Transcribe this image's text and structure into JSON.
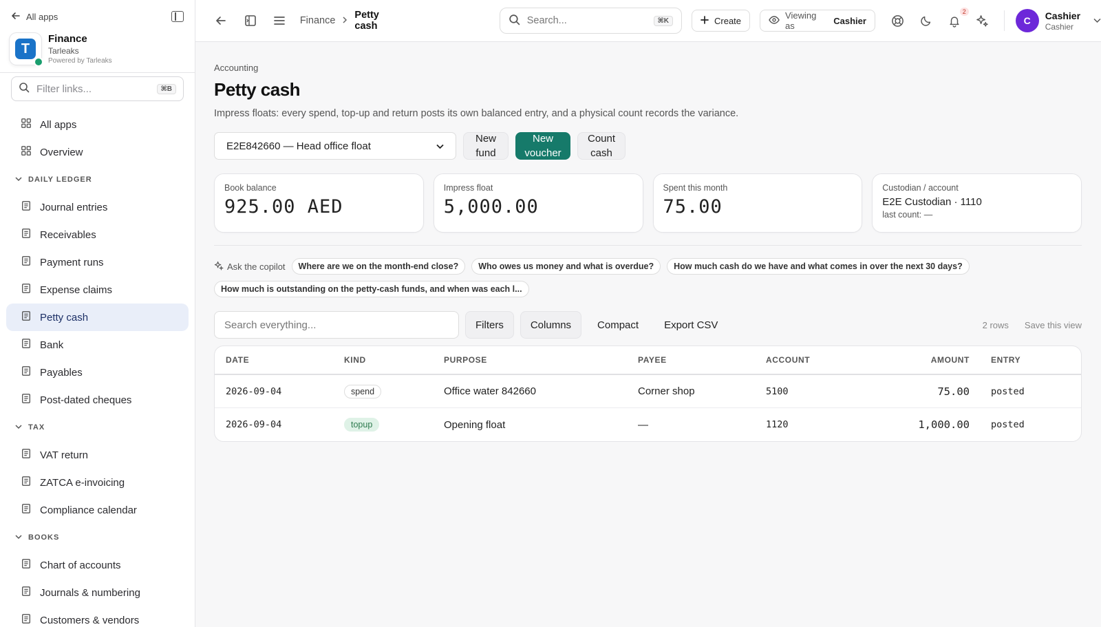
{
  "sidebar": {
    "back_label": "All apps",
    "org_name": "Finance",
    "org_sub": "Tarleaks",
    "org_powered": "Powered by Tarleaks",
    "org_logo_letter": "T",
    "filter_placeholder": "Filter links...",
    "filter_kbd": "⌘B",
    "top_items": [
      {
        "label": "All apps",
        "icon": "grid-icon"
      },
      {
        "label": "Overview",
        "icon": "grid-icon"
      }
    ],
    "sections": [
      {
        "title": "DAILY LEDGER",
        "items": [
          {
            "label": "Journal entries"
          },
          {
            "label": "Receivables"
          },
          {
            "label": "Payment runs"
          },
          {
            "label": "Expense claims"
          },
          {
            "label": "Petty cash",
            "active": true
          },
          {
            "label": "Bank"
          },
          {
            "label": "Payables"
          },
          {
            "label": "Post-dated cheques"
          }
        ]
      },
      {
        "title": "TAX",
        "items": [
          {
            "label": "VAT return"
          },
          {
            "label": "ZATCA e-invoicing"
          },
          {
            "label": "Compliance calendar"
          }
        ]
      },
      {
        "title": "BOOKS",
        "items": [
          {
            "label": "Chart of accounts"
          },
          {
            "label": "Journals & numbering"
          },
          {
            "label": "Customers & vendors"
          }
        ]
      }
    ]
  },
  "topbar": {
    "crumb_parent": "Finance",
    "crumb_current": "Petty cash",
    "search_placeholder": "Search...",
    "search_kbd": "⌘K",
    "create_label": "Create",
    "viewing_as_prefix": "Viewing as",
    "viewing_as_role": "Cashier",
    "notification_count": "2",
    "user_initial": "C",
    "user_name": "Cashier",
    "user_role": "Cashier"
  },
  "page": {
    "eyebrow": "Accounting",
    "title": "Petty cash",
    "description": "Impress floats: every spend, top-up and return posts its own balanced entry, and a physical count records the variance.",
    "fund_select": "E2E842660 — Head office float",
    "new_fund_label": "New fund",
    "new_voucher_label": "New voucher",
    "count_cash_label": "Count cash"
  },
  "cards": {
    "book_balance_label": "Book balance",
    "book_balance_value": "925.00 AED",
    "impress_label": "Impress float",
    "impress_value": "5,000.00",
    "spent_label": "Spent this month",
    "spent_value": "75.00",
    "custodian_label": "Custodian / account",
    "custodian_value": "E2E Custodian · 1110",
    "last_count": "last count: —"
  },
  "copilot": {
    "label": "Ask the copilot",
    "suggestions": [
      "Where are we on the month-end close?",
      "Who owes us money and what is overdue?",
      "How much cash do we have and what comes in over the next 30 days?",
      "How much is outstanding on the petty-cash funds, and when was each l..."
    ]
  },
  "table_toolbar": {
    "search_placeholder": "Search everything...",
    "filters": "Filters",
    "columns": "Columns",
    "compact": "Compact",
    "export": "Export CSV",
    "row_count": "2 rows",
    "save_view": "Save this view"
  },
  "table": {
    "headers": [
      "DATE",
      "KIND",
      "PURPOSE",
      "PAYEE",
      "ACCOUNT",
      "AMOUNT",
      "ENTRY"
    ],
    "rows": [
      {
        "date": "2026-09-04",
        "kind": "spend",
        "purpose": "Office water 842660",
        "payee": "Corner shop",
        "account": "5100",
        "amount": "75.00",
        "entry": "posted"
      },
      {
        "date": "2026-09-04",
        "kind": "topup",
        "purpose": "Opening float",
        "payee": "—",
        "account": "1120",
        "amount": "1,000.00",
        "entry": "posted"
      }
    ]
  },
  "colors": {
    "primary": "#167a6a",
    "active_nav_bg": "#e9eef9",
    "avatar": "#6d28d9",
    "logo": "#1a73c8"
  }
}
